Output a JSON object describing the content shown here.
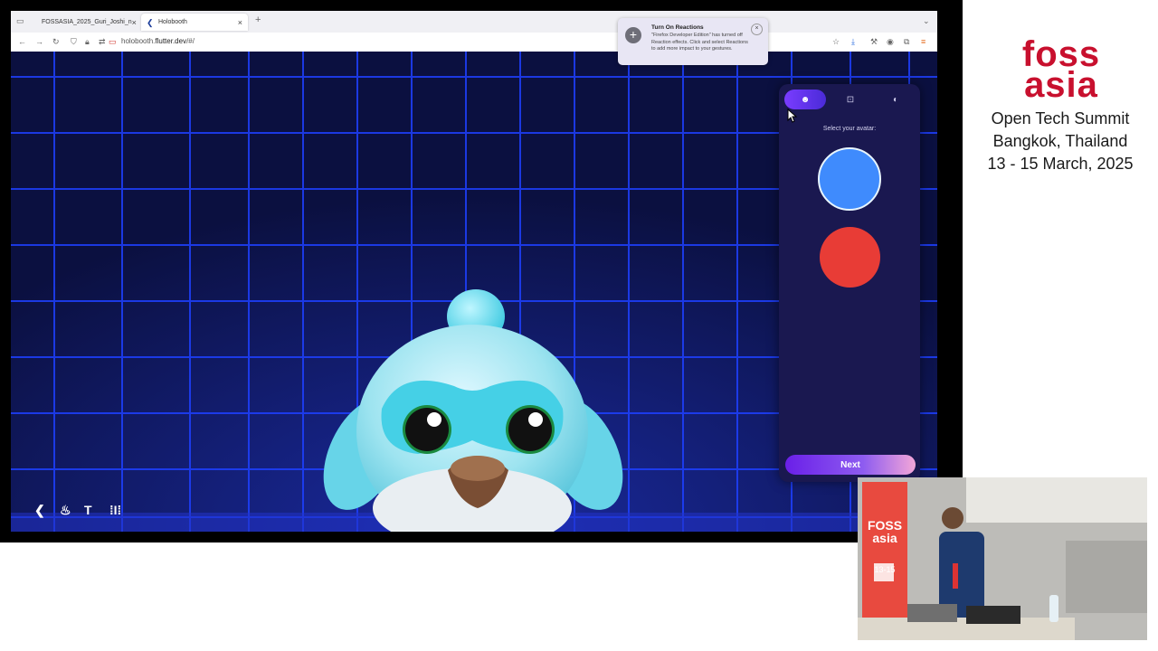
{
  "browser": {
    "tabs": [
      {
        "label": "FOSSASIA_2025_Guri_Joshi_n",
        "active": false
      },
      {
        "label": "Holobooth",
        "active": true
      }
    ],
    "new_tab": "+",
    "url_host": "holobooth.",
    "url_domain": "flutter.dev",
    "url_path": "/#/"
  },
  "popup": {
    "title": "Turn On Reactions",
    "body": "\"Firefox Developer Edition\" has turned off Reaction effects. Click  and select Reactions to add more impact to your gestures.",
    "close": "×"
  },
  "panel": {
    "tabs": [
      "avatar-tab",
      "background-tab",
      "props-tab"
    ],
    "label": "Select your avatar:",
    "avatars": [
      {
        "name": "blue",
        "color": "#3f8bfd",
        "selected": true
      },
      {
        "name": "red",
        "color": "#e83c36",
        "selected": false
      }
    ],
    "next_label": "Next"
  },
  "branding": {
    "logo_top": "foss",
    "logo_bottom": "asia",
    "line1": "Open Tech Summit",
    "line2": "Bangkok, Thailand",
    "line3": "13 - 15 March, 2025"
  },
  "colors": {
    "grid": "#1e40ff",
    "panel": "#1a1850",
    "accent": "#6a1fe8",
    "brand_red": "#c8102e"
  }
}
